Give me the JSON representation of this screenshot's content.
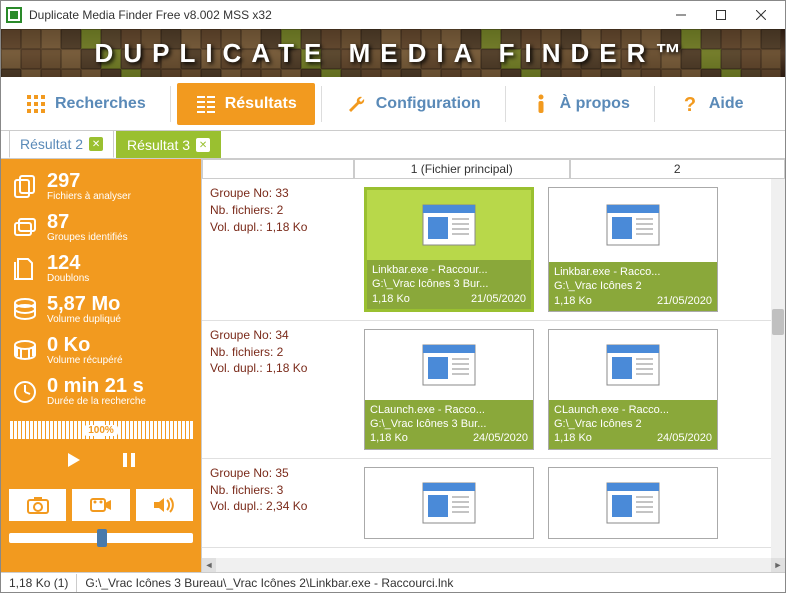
{
  "window": {
    "title": "Duplicate Media Finder Free    v8.002  MSS  x32"
  },
  "banner": {
    "text": "DUPLICATE MEDIA FINDER™"
  },
  "toolbar": {
    "recherches": "Recherches",
    "resultats": "Résultats",
    "configuration": "Configuration",
    "apropos": "À propos",
    "aide": "Aide"
  },
  "tabs": [
    {
      "label": "Résultat 2",
      "active": false
    },
    {
      "label": "Résultat 3",
      "active": true
    }
  ],
  "stats": {
    "files_to_analyze": {
      "value": "297",
      "label": "Fichiers à analyser"
    },
    "groups_identified": {
      "value": "87",
      "label": "Groupes identifiés"
    },
    "duplicates": {
      "value": "124",
      "label": "Doublons"
    },
    "dup_volume": {
      "value": "5,87 Mo",
      "label": "Volume dupliqué"
    },
    "recovered_volume": {
      "value": "0 Ko",
      "label": "Volume récupéré"
    },
    "search_time": {
      "value": "0 min  21 s",
      "label": "Durée de la recherche"
    },
    "progress": "100%"
  },
  "columns": {
    "c1": "1 (Fichier principal)",
    "c2": "2"
  },
  "groups": [
    {
      "id": "Groupe No: 33",
      "nbfiles": "Nb. fichiers: 2",
      "voldupl": "Vol. dupl.: 1,18 Ko",
      "selected": true,
      "items": [
        {
          "name": "Linkbar.exe - Raccour...",
          "path": "G:\\_Vrac Icônes 3 Bur...",
          "size": "1,18 Ko",
          "date": "21/05/2020"
        },
        {
          "name": "Linkbar.exe - Racco...",
          "path": "G:\\_Vrac Icônes 2",
          "size": "1,18 Ko",
          "date": "21/05/2020"
        }
      ]
    },
    {
      "id": "Groupe No: 34",
      "nbfiles": "Nb. fichiers: 2",
      "voldupl": "Vol. dupl.: 1,18 Ko",
      "selected": false,
      "items": [
        {
          "name": "CLaunch.exe - Racco...",
          "path": "G:\\_Vrac Icônes 3 Bur...",
          "size": "1,18 Ko",
          "date": "24/05/2020"
        },
        {
          "name": "CLaunch.exe - Racco...",
          "path": "G:\\_Vrac Icônes 2",
          "size": "1,18 Ko",
          "date": "24/05/2020"
        }
      ]
    },
    {
      "id": "Groupe No: 35",
      "nbfiles": "Nb. fichiers: 3",
      "voldupl": "Vol. dupl.: 2,34 Ko",
      "selected": false,
      "items": [
        {
          "name": "",
          "path": "",
          "size": "",
          "date": ""
        },
        {
          "name": "",
          "path": "",
          "size": "",
          "date": ""
        }
      ]
    }
  ],
  "statusbar": {
    "size": "1,18 Ko (1)",
    "path": "G:\\_Vrac Icônes 3 Bureau\\_Vrac Icônes 2\\Linkbar.exe - Raccourci.lnk"
  }
}
